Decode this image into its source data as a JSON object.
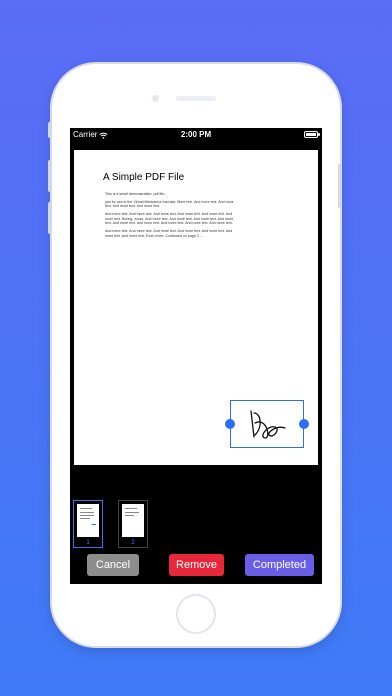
{
  "status_bar": {
    "carrier": "Carrier",
    "time": "2:00 PM"
  },
  "document": {
    "title": "A Simple PDF File",
    "paragraphs": [
      "This is a small demonstration .pdf file -",
      "just for use in the Virtual Mechanics tutorials. More text. And more text. And more text. And more text. And more text.",
      "And more text. And more text. And more text. And more text. And more text. And more text. Boring, zzzzz. And more text. And more text. And more text. And more text. And more text. And more text. And more text. And more text. And more text.",
      "And more text. And more text. And more text. And more text. And more text. And more text. And more text. Even more. Continued on page 2 ..."
    ]
  },
  "thumbnails": [
    {
      "label": "1",
      "selected": true
    },
    {
      "label": "2",
      "selected": false
    }
  ],
  "toolbar": {
    "cancel_label": "Cancel",
    "remove_label": "Remove",
    "completed_label": "Completed"
  },
  "icons": {
    "wifi": "wifi-icon",
    "battery": "battery-icon",
    "signature": "signature-icon"
  },
  "colors": {
    "background_top": "#5b6cf6",
    "background_bottom": "#3f7bf8",
    "selection_blue": "#2b6ef5",
    "cancel": "#8d8d8d",
    "remove": "#e8273a",
    "completed": "#6b5ee6"
  }
}
